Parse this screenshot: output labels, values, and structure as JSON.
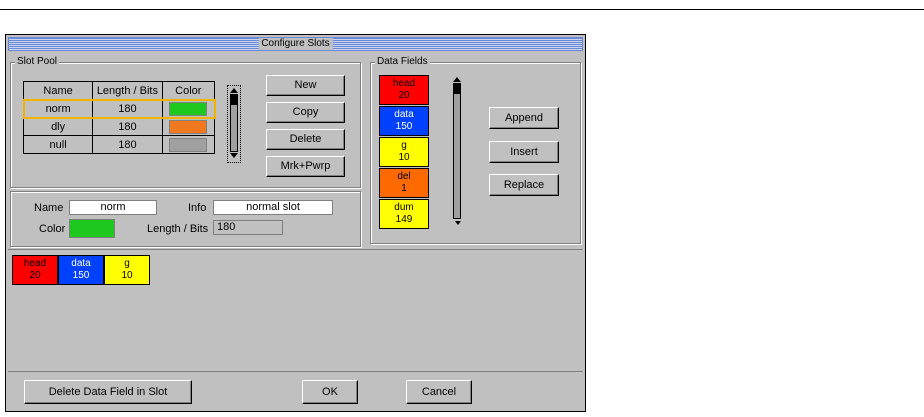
{
  "window": {
    "title": "Configure Slots"
  },
  "slot_pool": {
    "label": "Slot Pool",
    "headers": [
      "Name",
      "Length / Bits",
      "Color"
    ],
    "rows": [
      {
        "name": "norm",
        "length": "180",
        "color": "#1ec81e"
      },
      {
        "name": "dly",
        "length": "180",
        "color": "#f0781e"
      },
      {
        "name": "null",
        "length": "180",
        "color": "#a0a0a0"
      }
    ],
    "buttons": {
      "new": "New",
      "copy": "Copy",
      "delete": "Delete",
      "mrk": "Mrk+Pwrp"
    }
  },
  "details": {
    "name_label": "Name",
    "name_value": "norm",
    "info_label": "Info",
    "info_value": "normal slot",
    "color_label": "Color",
    "color_value": "#1ec81e",
    "length_label": "Length / Bits",
    "length_value": "180"
  },
  "data_fields": {
    "label": "Data Fields",
    "items": [
      {
        "name": "head",
        "value": "20",
        "color": "#ff0000",
        "text_color": "#000000"
      },
      {
        "name": "data",
        "value": "150",
        "color": "#0040ff",
        "text_color": "#ffffff"
      },
      {
        "name": "g",
        "value": "10",
        "color": "#ffff00",
        "text_color": "#000000"
      },
      {
        "name": "del",
        "value": "1",
        "color": "#ff6a00",
        "text_color": "#000000"
      },
      {
        "name": "dum",
        "value": "149",
        "color": "#ffff00",
        "text_color": "#000000"
      }
    ],
    "buttons": {
      "append": "Append",
      "insert": "Insert",
      "replace": "Replace"
    }
  },
  "slot_content": [
    {
      "name": "head",
      "value": "20",
      "color": "#ff0000",
      "text_color": "#000000"
    },
    {
      "name": "data",
      "value": "150",
      "color": "#0040ff",
      "text_color": "#ffffff"
    },
    {
      "name": "g",
      "value": "10",
      "color": "#ffff00",
      "text_color": "#000000"
    }
  ],
  "footer": {
    "delete_field": "Delete Data Field in Slot",
    "ok": "OK",
    "cancel": "Cancel"
  },
  "colors": {
    "selection_outline": "#f0b400"
  }
}
